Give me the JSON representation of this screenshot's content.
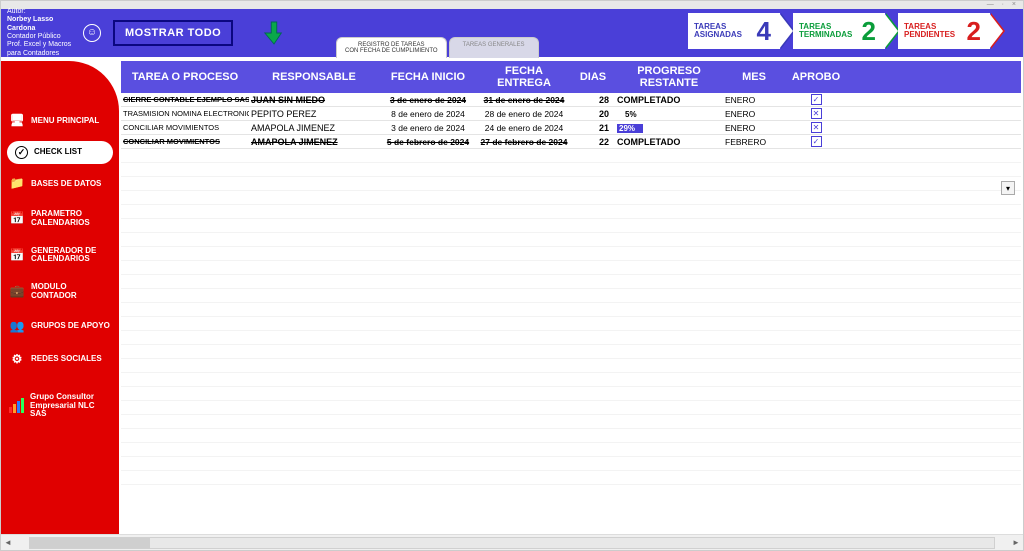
{
  "titlebar": {
    "controls": "— · ×"
  },
  "author": {
    "label": "Autor:",
    "name": "Norbey Lasso Cardona",
    "role": "Contador Público",
    "sub": "Prof. Excel y Macros para Contadores"
  },
  "show_all": "MOSTRAR TODO",
  "tabs": {
    "active": "REGISTRO DE TAREAS\nCON FECHA DE CUMPLIMIENTO",
    "inactive": "TAREAS GENERALES"
  },
  "counters": {
    "assigned": {
      "label": "TAREAS\nASIGNADAS",
      "value": "4"
    },
    "done": {
      "label": "TAREAS\nTERMINADAS",
      "value": "2"
    },
    "pending": {
      "label": "TAREAS\nPENDIENTES",
      "value": "2"
    }
  },
  "sidebar": {
    "items": [
      {
        "icon": "🖥",
        "label": "MENU PRINCIPAL"
      },
      {
        "icon": "✓",
        "label": "CHECK LIST",
        "active": true
      },
      {
        "icon": "📁",
        "label": "BASES DE DATOS"
      },
      {
        "icon": "📅",
        "label": "PARAMETRO CALENDARIOS"
      },
      {
        "icon": "📅",
        "label": "GENERADOR DE CALENDARIOS"
      },
      {
        "icon": "💼",
        "label": "MODULO CONTADOR"
      },
      {
        "icon": "👥",
        "label": "GRUPOS DE APOYO"
      },
      {
        "icon": "⚙",
        "label": "REDES SOCIALES"
      },
      {
        "icon": "logo",
        "label": "Grupo Consultor Empresarial NLC SAS"
      }
    ]
  },
  "columns": {
    "c1": "TAREA O PROCESO",
    "c2": "RESPONSABLE",
    "c3": "FECHA INICIO",
    "c4": "FECHA ENTREGA",
    "c5": "DIAS",
    "c6": "PROGRESO RESTANTE",
    "c7": "MES",
    "c8": "APROBO"
  },
  "rows": [
    {
      "tarea": "CIERRE CONTABLE EJEMPLO SAS",
      "resp": "JUAN SIN MIEDO",
      "ini": "3 de enero de 2024",
      "fin": "31 de enero de 2024",
      "dias": "28",
      "prog": "COMPLETADO",
      "mes": "ENERO",
      "apr": "check",
      "done": true
    },
    {
      "tarea": "TRASMISION NOMINA ELECTRONICA DICIEMBRE",
      "resp": "PEPITO PEREZ",
      "ini": "8 de enero de 2024",
      "fin": "28 de enero de 2024",
      "dias": "20",
      "prog": "5%",
      "mes": "ENERO",
      "apr": "x",
      "done": false,
      "bar": false
    },
    {
      "tarea": "CONCILIAR MOVIMIENTOS",
      "resp": "AMAPOLA JIMENEZ",
      "ini": "3 de enero de 2024",
      "fin": "24 de enero de 2024",
      "dias": "21",
      "prog": "29%",
      "mes": "ENERO",
      "apr": "x",
      "done": false,
      "bar": true
    },
    {
      "tarea": "CONCILIAR MOVIMIENTOS",
      "resp": "AMAPOLA JIMENEZ",
      "ini": "5 de febrero de 2024",
      "fin": "27 de febrero de 2024",
      "dias": "22",
      "prog": "COMPLETADO",
      "mes": "FEBRERO",
      "apr": "check",
      "done": true
    }
  ]
}
